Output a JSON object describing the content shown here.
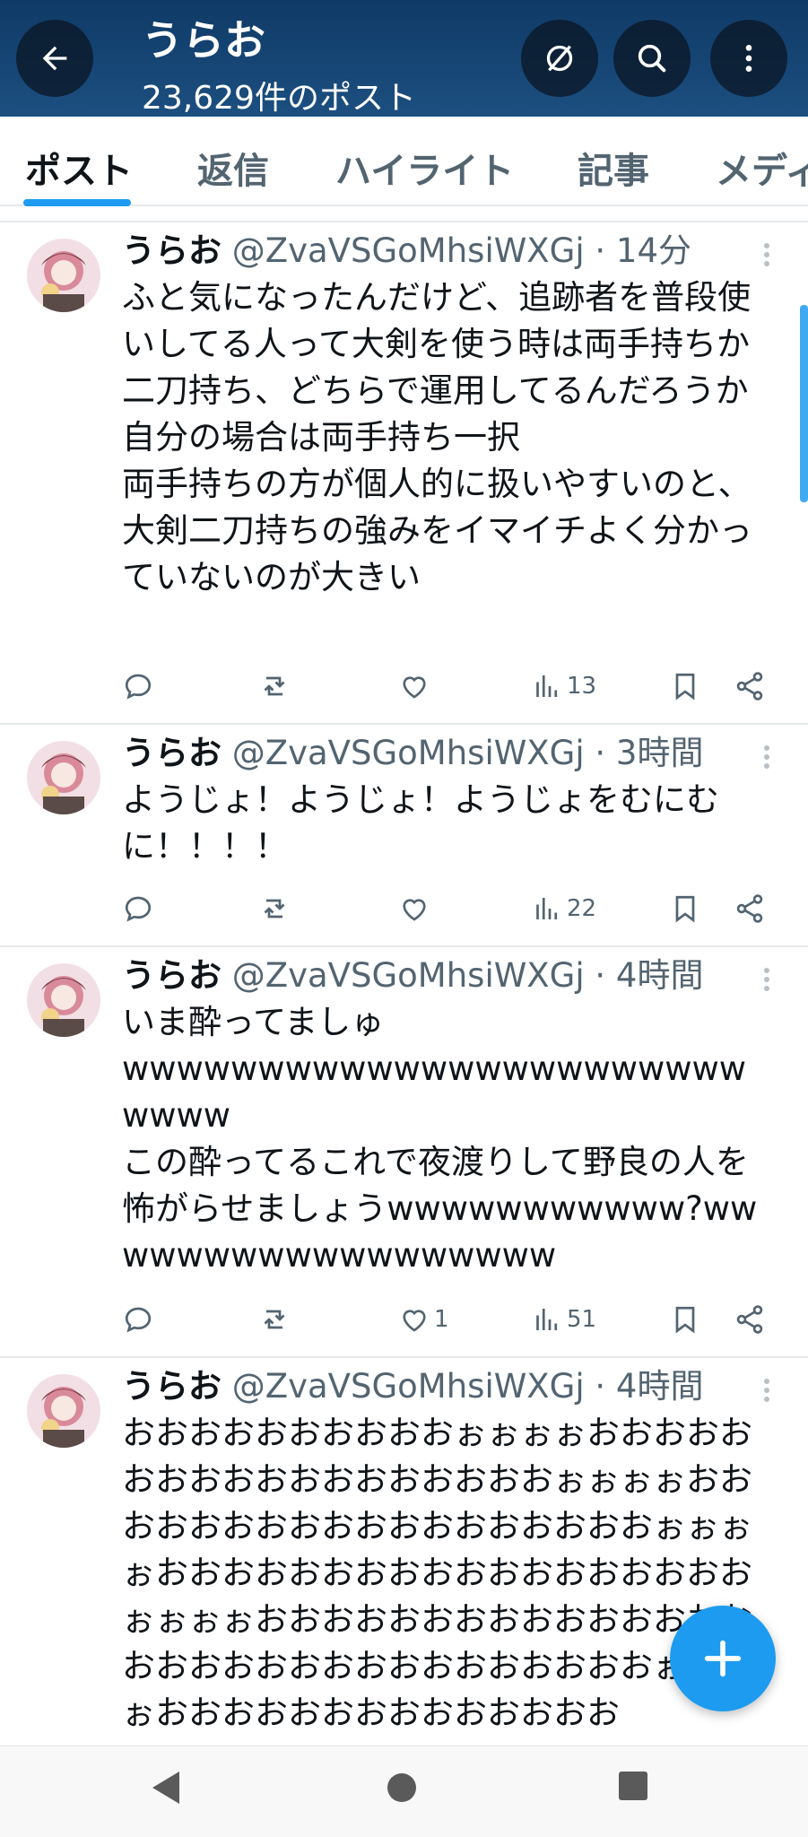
{
  "header": {
    "title": "うらお",
    "post_count": "23,629件のポスト"
  },
  "tabs": [
    "ポスト",
    "返信",
    "ハイライト",
    "記事",
    "メディ"
  ],
  "posts": [
    {
      "name": "うらお",
      "handle": "@ZvaVSGoMhsiWXGj",
      "time": "· 14分",
      "text": "ふと気になったんだけど、追跡者を普段使いしてる人って大剣を使う時は両手持ちか二刀持ち、どちらで運用してるんだろうか\n自分の場合は両手持ち一択\n両手持ちの方が個人的に扱いやすいのと、大剣二刀持ちの強みをイマイチよく分かっていないのが大きい",
      "likes": "",
      "views": "13"
    },
    {
      "name": "うらお",
      "handle": "@ZvaVSGoMhsiWXGj",
      "time": "· 3時間",
      "text": "ようじょ！ようじょ！ようじょをむにむに！！！！",
      "likes": "",
      "views": "22"
    },
    {
      "name": "うらお",
      "handle": "@ZvaVSGoMhsiWXGj",
      "time": "· 4時間",
      "text": "いま酔ってましゅ\nwwwwwwwwwwwwwwwwwwwwwwwwwww\nこの酔ってるこれで夜渡りして野良の人を怖がらせましょうwwwwwwwwwww?wwwwwwwwwwwwwwwwww",
      "likes": "1",
      "views": "51"
    },
    {
      "name": "うらお",
      "handle": "@ZvaVSGoMhsiWXGj",
      "time": "· 4時間",
      "text": "おおおおおおおおおおぉぉぉぉおおおおおおおおおおおおおおおおおおぉぉぉぉおおおおおおおおおおおおおおおおおおぉぉぉぉおおおおおおおおおおおおおおおおおおぉぉぉぉおおおおおおおおおおおおおおおおおおおおおおおおおおおおおおおぉぉぉぉおおおおおおおおおおおおおお",
      "likes": "",
      "views": ""
    }
  ],
  "icons": {
    "back": "arrow-left-icon",
    "no_translate": "slashed-circle-icon",
    "search": "search-icon",
    "more": "more-vertical-icon",
    "reply": "reply-icon",
    "repost": "repost-icon",
    "like": "heart-icon",
    "views": "views-bar-icon",
    "bookmark": "bookmark-icon",
    "share": "share-icon",
    "compose": "plus-icon"
  },
  "colors": {
    "accent": "#1d9bf0",
    "header_bg": "#15456f",
    "text_primary": "#0f1419",
    "text_secondary": "#536471"
  }
}
